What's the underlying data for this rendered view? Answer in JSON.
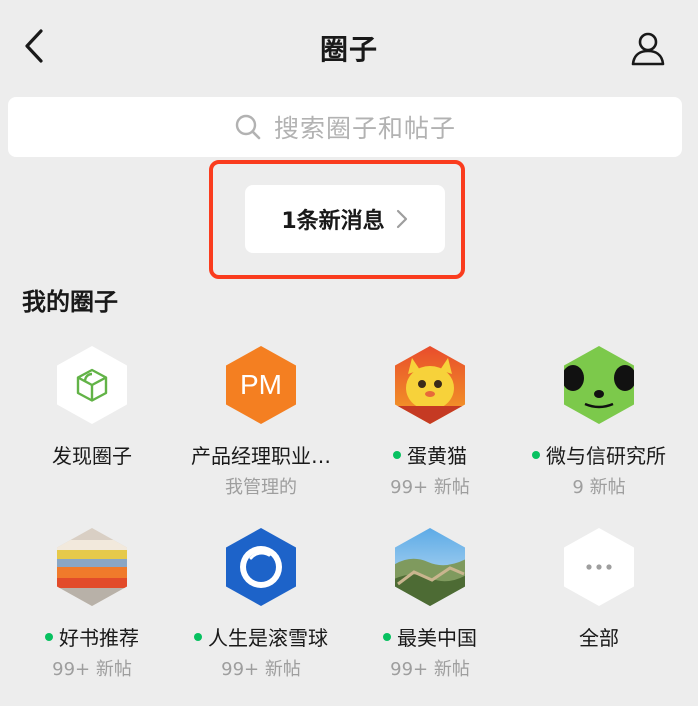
{
  "nav": {
    "title": "圈子"
  },
  "search": {
    "placeholder": "搜索圈子和帖子"
  },
  "new_message": {
    "label": "1条新消息"
  },
  "section": {
    "title": "我的圈子"
  },
  "circles": [
    {
      "name": "发现圈子",
      "sub": "",
      "dot": false,
      "icon": "cube-icon"
    },
    {
      "name": "产品经理职业…",
      "sub": "我管理的",
      "dot": false,
      "icon": "pm-logo",
      "logo_text": "PM"
    },
    {
      "name": "蛋黄猫",
      "sub": "99+ 新帖",
      "dot": true,
      "icon": "cat-avatar"
    },
    {
      "name": "微与信研究所",
      "sub": "9 新帖",
      "dot": true,
      "icon": "panda-avatar"
    },
    {
      "name": "好书推荐",
      "sub": "99+ 新帖",
      "dot": true,
      "icon": "books-avatar"
    },
    {
      "name": "人生是滚雪球",
      "sub": "99+ 新帖",
      "dot": true,
      "icon": "snowball-ring-avatar"
    },
    {
      "name": "最美中国",
      "sub": "99+ 新帖",
      "dot": true,
      "icon": "great-wall-avatar"
    },
    {
      "name": "全部",
      "sub": "",
      "dot": false,
      "icon": "more-dots-icon"
    }
  ],
  "colors": {
    "accent": "#07c160",
    "highlight": "#fa3c1e",
    "pm_orange": "#f47f21",
    "ring_blue": "#1d63c9"
  }
}
